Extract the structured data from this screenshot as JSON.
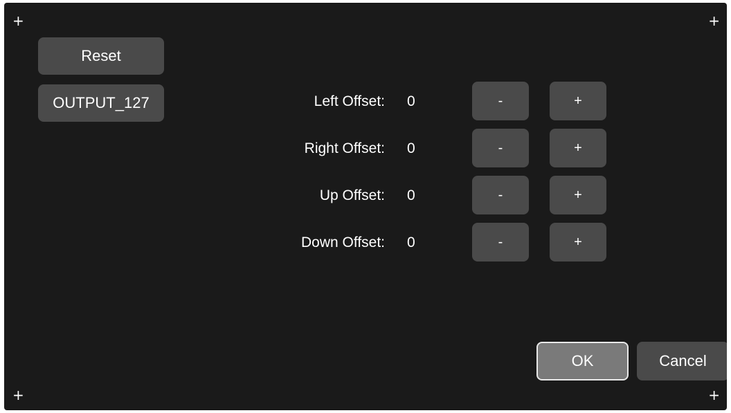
{
  "corners": {
    "top_left": "+",
    "top_right": "+",
    "bottom_left": "+",
    "bottom_right": "+"
  },
  "buttons": {
    "reset": "Reset",
    "output": "OUTPUT_127",
    "ok": "OK",
    "cancel": "Cancel"
  },
  "offsets": [
    {
      "label": "Left Offset:",
      "value": "0",
      "minus": "-",
      "plus": "+"
    },
    {
      "label": "Right Offset:",
      "value": "0",
      "minus": "-",
      "plus": "+"
    },
    {
      "label": "Up Offset:",
      "value": "0",
      "minus": "-",
      "plus": "+"
    },
    {
      "label": "Down Offset:",
      "value": "0",
      "minus": "-",
      "plus": "+"
    }
  ]
}
